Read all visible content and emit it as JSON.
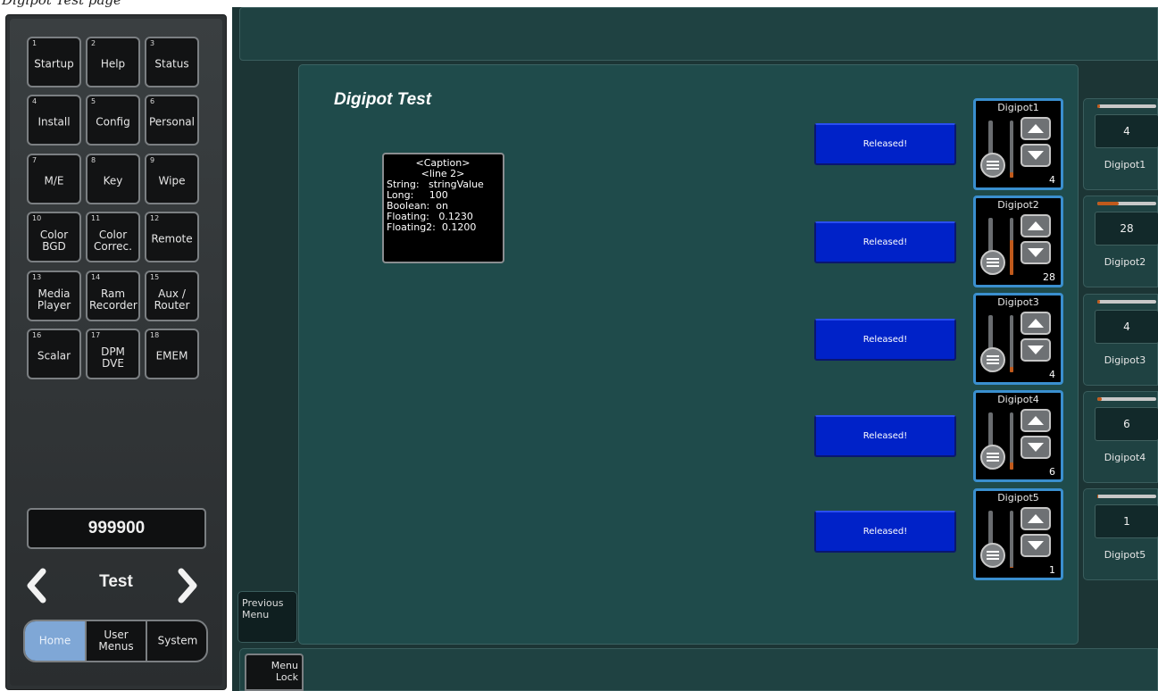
{
  "doc_caption": "Digipot Test page",
  "sidebar": {
    "buttons": [
      {
        "num": "1",
        "label": "Startup"
      },
      {
        "num": "2",
        "label": "Help"
      },
      {
        "num": "3",
        "label": "Status"
      },
      {
        "num": "4",
        "label": "Install"
      },
      {
        "num": "5",
        "label": "Config"
      },
      {
        "num": "6",
        "label": "Personal"
      },
      {
        "num": "7",
        "label": "M/E"
      },
      {
        "num": "8",
        "label": "Key"
      },
      {
        "num": "9",
        "label": "Wipe"
      },
      {
        "num": "10",
        "label": "Color\nBGD"
      },
      {
        "num": "11",
        "label": "Color\nCorrec."
      },
      {
        "num": "12",
        "label": "Remote"
      },
      {
        "num": "13",
        "label": "Media\nPlayer"
      },
      {
        "num": "14",
        "label": "Ram\nRecorder"
      },
      {
        "num": "15",
        "label": "Aux /\nRouter"
      },
      {
        "num": "16",
        "label": "Scalar"
      },
      {
        "num": "17",
        "label": "DPM\nDVE"
      },
      {
        "num": "18",
        "label": "EMEM"
      }
    ],
    "number_display": "999900",
    "menu_name": "Test",
    "tabs": {
      "home": "Home",
      "user": "User\nMenus",
      "system": "System"
    }
  },
  "main": {
    "title": "Digipot Test",
    "caption": {
      "line1": "<Caption>",
      "line2": "<line 2>",
      "rows": [
        "String:   stringValue",
        "Long:     100",
        "Boolean:  on",
        "Floating:   0.1230",
        "Floating2:  0.1200"
      ]
    },
    "released_label": "Released!",
    "digipots": [
      {
        "name": "Digipot1",
        "value": "4",
        "level": 0.04
      },
      {
        "name": "Digipot2",
        "value": "28",
        "level": 0.28
      },
      {
        "name": "Digipot3",
        "value": "4",
        "level": 0.04
      },
      {
        "name": "Digipot4",
        "value": "6",
        "level": 0.06
      },
      {
        "name": "Digipot5",
        "value": "1",
        "level": 0.01
      }
    ]
  },
  "previous_menu": "Previous\nMenu",
  "menu_lock": "Menu\nLock",
  "colors": {
    "released_button": "#0022c8",
    "digipot_border": "#3a8fcf",
    "level_fill": "#c05a1c",
    "home_tab": "#7fa7d6"
  }
}
